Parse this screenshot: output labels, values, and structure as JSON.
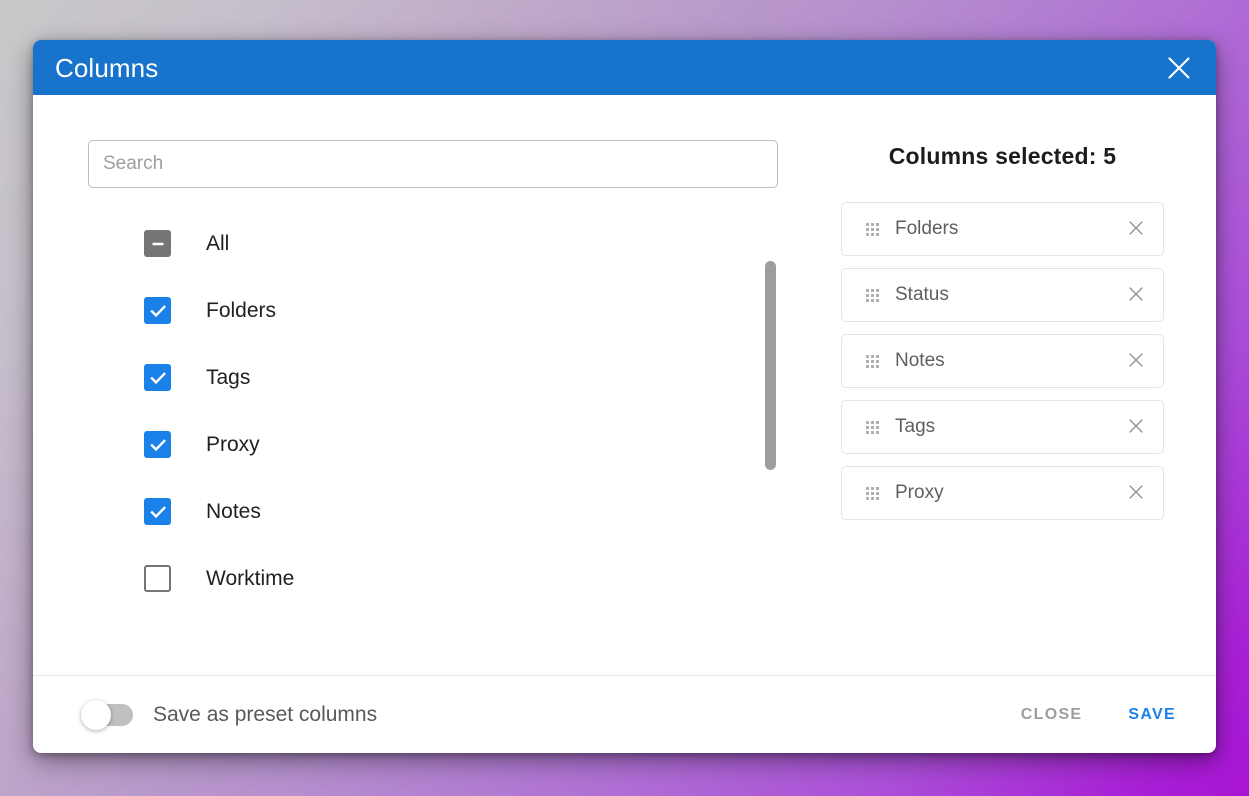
{
  "dialog": {
    "title": "Columns",
    "close_icon": "close-icon"
  },
  "search": {
    "placeholder": "Search",
    "value": ""
  },
  "column_list": [
    {
      "label": "All",
      "state": "indeterminate"
    },
    {
      "label": "Folders",
      "state": "checked"
    },
    {
      "label": "Tags",
      "state": "checked"
    },
    {
      "label": "Proxy",
      "state": "checked"
    },
    {
      "label": "Notes",
      "state": "checked"
    },
    {
      "label": "Worktime",
      "state": "unchecked"
    }
  ],
  "selected_panel": {
    "title": "Columns selected: 5",
    "chips": [
      {
        "label": "Folders"
      },
      {
        "label": "Status"
      },
      {
        "label": "Notes"
      },
      {
        "label": "Tags"
      },
      {
        "label": "Proxy"
      }
    ]
  },
  "footer": {
    "preset_toggle_label": "Save as preset columns",
    "preset_toggle_on": false,
    "close_label": "CLOSE",
    "save_label": "SAVE"
  },
  "colors": {
    "header_blue": "#1873cd",
    "accent_blue": "#1a81e8",
    "checkbox_gray": "#757575",
    "muted_text": "#9e9e9e"
  }
}
